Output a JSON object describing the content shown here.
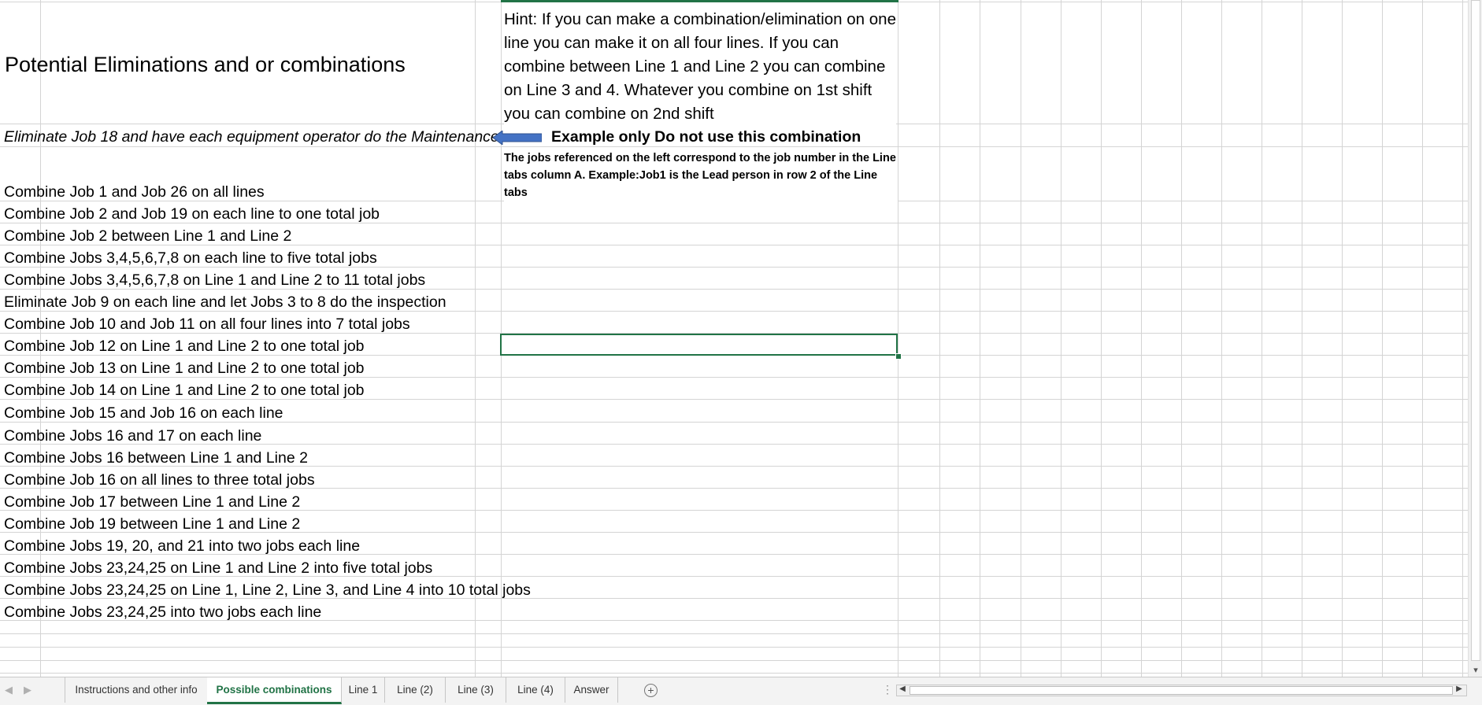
{
  "sheet": {
    "title": "Potential Eliminations and or combinations",
    "hint": "Hint: If you can make a combination/elimination on one line you can make it on all four lines. If you can combine between Line 1 and Line 2 you can combine on Line 3 and 4. Whatever you combine on 1st shift you can combine on 2nd shift",
    "example_row": "Eliminate  Job 18 and have each equipment operator do the Maintenance",
    "example_label": "Example only  Do not use this combination",
    "reference_note": "The jobs referenced on the left correspond to the job number in the Line tabs column A. Example:Job1 is the Lead person in row 2 of the Line tabs",
    "rows": [
      "Combine Job 1 and Job 26 on all lines",
      "Combine Job 2 and Job 19 on each line to one total job",
      "Combine Job 2 between Line 1 and Line 2",
      "Combine Jobs 3,4,5,6,7,8 on each line to five total jobs",
      "Combine Jobs 3,4,5,6,7,8 on Line 1 and Line 2 to 11 total jobs",
      "Eliminate Job 9 on each line and let  Jobs 3 to 8 do the inspection",
      "Combine Job 10 and Job 11 on all four lines into 7 total jobs",
      "Combine Job 12 on Line 1 and Line 2 to one total job",
      "Combine Job 13 on Line 1 and Line 2 to one total job",
      "Combine Job 14 on Line 1 and Line 2 to one total job",
      "Combine Job 15 and Job 16 on each line",
      "Combine Jobs 16 and 17 on each line",
      "Combine Jobs 16 between Line 1 and Line 2",
      "Combine Job 16 on all lines to three total jobs",
      "Combine Job 17 between Line 1 and Line 2",
      "Combine Job 19 between Line 1 and Line 2",
      "Combine Jobs 19, 20, and 21 into two jobs each line",
      "Combine  Jobs 23,24,25 on Line 1 and Line 2 into five total jobs",
      "Combine  Jobs 23,24,25 on Line 1, Line 2, Line 3, and Line 4 into 10 total jobs",
      "Combine  Jobs 23,24,25 into two jobs each line"
    ]
  },
  "tabs": [
    {
      "label": "Instructions and other info",
      "active": false
    },
    {
      "label": "Possible combinations",
      "active": true
    },
    {
      "label": "Line 1",
      "active": false
    },
    {
      "label": "Line  (2)",
      "active": false
    },
    {
      "label": "Line  (3)",
      "active": false
    },
    {
      "label": "Line  (4)",
      "active": false
    },
    {
      "label": "Answer",
      "active": false
    }
  ],
  "colors": {
    "accent": "#217346",
    "arrow": "#4472c4",
    "gridline": "#d4d4d4"
  },
  "icons": {
    "add_sheet": "plus-circle-icon",
    "arrow": "left-arrow-shape"
  }
}
